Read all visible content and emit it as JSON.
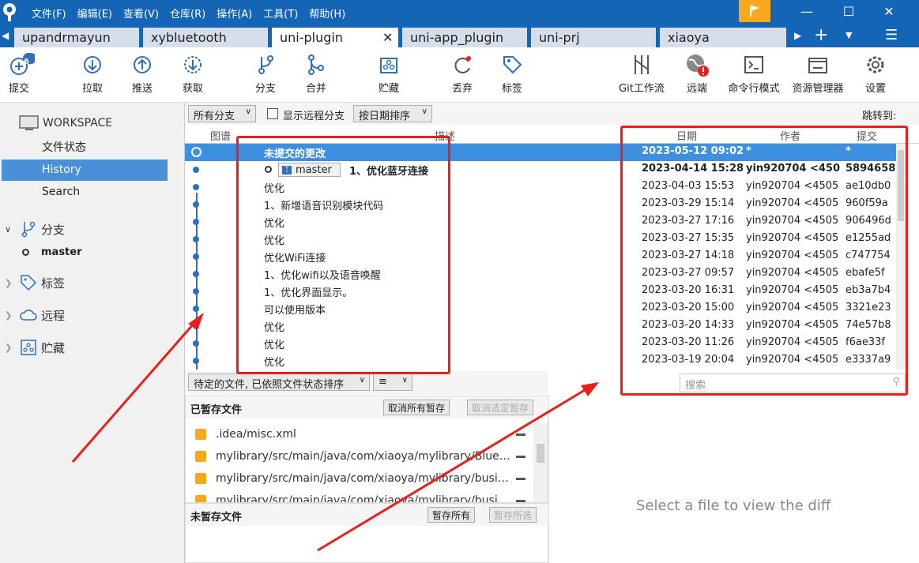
{
  "menu": [
    "文件(F)",
    "编辑(E)",
    "查看(V)",
    "仓库(R)",
    "操作(A)",
    "工具(T)",
    "帮助(H)"
  ],
  "tabs": [
    "upandrmayun",
    "xybluetooth",
    "uni-plugin",
    "uni-app_plugin",
    "uni-prj",
    "xiaoya"
  ],
  "active_tab": "uni-plugin",
  "toolbar": {
    "commit": "提交",
    "commit_badge": "6",
    "pull": "拉取",
    "push": "推送",
    "fetch": "获取",
    "branch": "分支",
    "merge": "合并",
    "stash": "贮藏",
    "discard": "丢弃",
    "tag": "标签",
    "gitflow": "Git工作流",
    "remote": "远端",
    "terminal": "命令行模式",
    "explorer": "资源管理器",
    "settings": "设置"
  },
  "sidebar": {
    "workspace": "WORKSPACE",
    "items": [
      "文件状态",
      "History",
      "Search"
    ],
    "selected": "History",
    "branches": "分支",
    "branch_master": "master",
    "tags": "标签",
    "remotes": "远程",
    "stashes": "贮藏"
  },
  "filters": {
    "branches": "所有分支",
    "show_remote": "显示远程分支",
    "sort": "按日期排序",
    "jump": "跳转到:"
  },
  "columns": {
    "graph": "图谱",
    "desc": "描述",
    "date": "日期",
    "author": "作者",
    "commit": "提交"
  },
  "commits": [
    {
      "desc": "未提交的更改",
      "date": "2023-05-12 09:02",
      "author": "*",
      "hash": "*"
    },
    {
      "desc": "1、优化蓝牙连接",
      "branch": "master",
      "date": "2023-04-14 15:28",
      "author": "yin920704 <450",
      "hash": "5894658"
    },
    {
      "desc": "优化",
      "date": "2023-04-03 15:53",
      "author": "yin920704 <4505",
      "hash": "ae10db0"
    },
    {
      "desc": "1、新增语音识别模块代码",
      "date": "2023-03-29 15:14",
      "author": "yin920704 <4505",
      "hash": "960f59a"
    },
    {
      "desc": "优化",
      "date": "2023-03-27 17:16",
      "author": "yin920704 <4505",
      "hash": "906496d"
    },
    {
      "desc": "优化",
      "date": "2023-03-27 15:35",
      "author": "yin920704 <4505",
      "hash": "e1255ad"
    },
    {
      "desc": "优化WiFi连接",
      "date": "2023-03-27 14:18",
      "author": "yin920704 <4505",
      "hash": "c747754"
    },
    {
      "desc": "1、优化wifi以及语音唤醒",
      "date": "2023-03-27 09:57",
      "author": "yin920704 <4505",
      "hash": "ebafe5f"
    },
    {
      "desc": "1、优化界面显示。",
      "date": "2023-03-20 16:31",
      "author": "yin920704 <4505",
      "hash": "eb3a7b4"
    },
    {
      "desc": "可以使用版本",
      "date": "2023-03-20 15:00",
      "author": "yin920704 <4505",
      "hash": "3321e23"
    },
    {
      "desc": "优化",
      "date": "2023-03-20 14:33",
      "author": "yin920704 <4505",
      "hash": "74e57b8"
    },
    {
      "desc": "优化",
      "date": "2023-03-20 11:26",
      "author": "yin920704 <4505",
      "hash": "f6ae33f"
    },
    {
      "desc": "优化",
      "date": "2023-03-19 20:04",
      "author": "yin920704 <4505",
      "hash": "e3337a9"
    }
  ],
  "pending": {
    "label": "待定的文件, 已依照文件状态排序",
    "view": "≡"
  },
  "search_placeholder": "搜索",
  "staged": {
    "title": "已暂存文件",
    "unstage_all": "取消所有暂存",
    "unstage_sel": "取消选定暂存",
    "files": [
      ".idea/misc.xml",
      "mylibrary/src/main/java/com/xiaoya/mylibrary/Bluetoo...",
      "mylibrary/src/main/java/com/xiaoya/mylibrary/busines...",
      "mylibrary/src/main/java/com/xiaoya/mylibrary/busines..."
    ]
  },
  "unstaged": {
    "title": "未暂存文件",
    "stage_all": "暂存所有",
    "stage_sel": "暂存所选"
  },
  "diff_message": "Select a file to view the diff",
  "colors": {
    "titlebar": "#1565b7",
    "selection": "#3d8fdf",
    "annotation": "#e8201c"
  }
}
